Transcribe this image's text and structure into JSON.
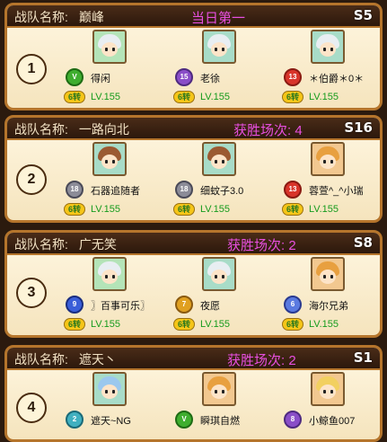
{
  "teams": [
    {
      "rank_num": "1",
      "label": "战队名称:",
      "team_name": "巅峰",
      "status": "当日第一",
      "server": "S5",
      "members": [
        {
          "name": "得闲",
          "level": "LV.155",
          "coin": "6转",
          "badge_icon": "green-shield-v-badge-icon",
          "avatar_icon": "white-hair-avatar-icon",
          "hair": "#e8eef2"
        },
        {
          "name": "老徐",
          "level": "LV.155",
          "coin": "6转",
          "badge_icon": "purple-crown-15-badge-icon",
          "avatar_icon": "white-hair-avatar-icon",
          "hair": "#e8eef2"
        },
        {
          "name": "＊伯爵＊0＊",
          "level": "LV.155",
          "coin": "6转",
          "badge_icon": "red-winged-13-badge-icon",
          "avatar_icon": "white-hair-avatar-icon",
          "hair": "#e8eef2"
        }
      ]
    },
    {
      "rank_num": "2",
      "label": "战队名称:",
      "team_name": "一路向北",
      "status": "获胜场次: 4",
      "server": "S16",
      "members": [
        {
          "name": "石器追随者",
          "level": "LV.155",
          "coin": "6转",
          "badge_icon": "grey-wing-badge-icon",
          "avatar_icon": "brown-hair-avatar-icon",
          "hair": "#9b5a32"
        },
        {
          "name": "细蚊子3.0",
          "level": "LV.155",
          "coin": "6转",
          "badge_icon": "grey-wing-badge-icon",
          "avatar_icon": "brown-hair-avatar-icon",
          "hair": "#9b5a32"
        },
        {
          "name": "蓉萱^_^小瑞",
          "level": "LV.155",
          "coin": "6转",
          "badge_icon": "red-winged-13-badge-icon",
          "avatar_icon": "orange-hair-avatar-icon",
          "hair": "#e8a040"
        }
      ]
    },
    {
      "rank_num": "3",
      "label": "战队名称:",
      "team_name": "广无笑",
      "status": "获胜场次: 2",
      "server": "S8",
      "members": [
        {
          "name": "〗百事可乐〗",
          "level": "LV.155",
          "coin": "6转",
          "badge_icon": "blue-9-badge-icon",
          "avatar_icon": "white-hair-avatar-icon",
          "hair": "#e8eef2"
        },
        {
          "name": "夜愿",
          "level": "LV.155",
          "coin": "6转",
          "badge_icon": "gold-7-badge-icon",
          "avatar_icon": "white-hair-avatar-icon",
          "hair": "#e8eef2"
        },
        {
          "name": "海尔兄弟",
          "level": "LV.155",
          "coin": "6转",
          "badge_icon": "blue-wing-badge-icon",
          "avatar_icon": "orange-hair-avatar-icon",
          "hair": "#e8a040"
        }
      ]
    },
    {
      "rank_num": "4",
      "label": "战队名称:",
      "team_name": "遮天丶",
      "status": "获胜场次: 2",
      "server": "S1",
      "members": [
        {
          "name": "遮天~NG",
          "level": "",
          "coin": "",
          "badge_icon": "teal-badge-icon",
          "avatar_icon": "blue-hair-avatar-icon",
          "hair": "#9bc8ee"
        },
        {
          "name": "瞬琪自燃",
          "level": "",
          "coin": "",
          "badge_icon": "green-shield-v-badge-icon",
          "avatar_icon": "orange-hair-avatar-icon",
          "hair": "#e8a040"
        },
        {
          "name": "小鲸鱼007",
          "level": "",
          "coin": "",
          "badge_icon": "purple-8-badge-icon",
          "avatar_icon": "blonde-hair-avatar-icon",
          "hair": "#f2d060"
        }
      ]
    }
  ],
  "colors": {
    "status": "#e84fe0",
    "level": "#159b1d",
    "border": "#b5752c",
    "header_bg": "#3a2212"
  }
}
